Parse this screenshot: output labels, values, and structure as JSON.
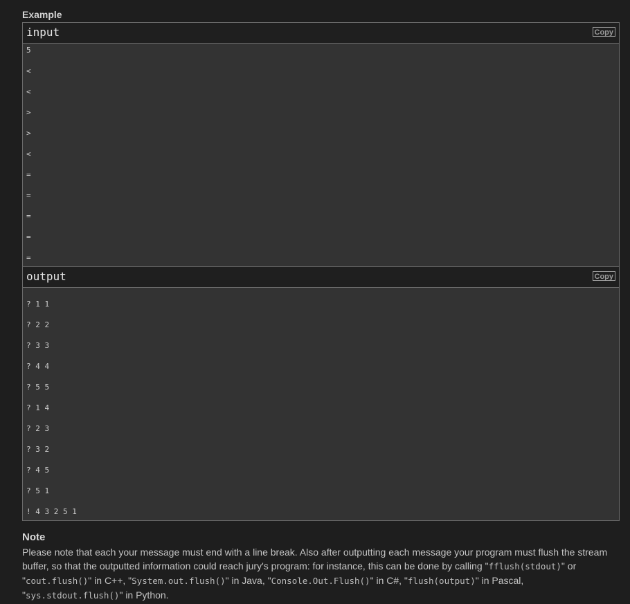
{
  "example": {
    "title": "Example"
  },
  "input": {
    "title": "input",
    "copy_label": "Copy",
    "lines": [
      "5",
      "<",
      "<",
      ">",
      ">",
      "<",
      "=",
      "=",
      "=",
      "=",
      "="
    ]
  },
  "output": {
    "title": "output",
    "copy_label": "Copy",
    "lines": [
      "? 1 1",
      "? 2 2",
      "? 3 3",
      "? 4 4",
      "? 5 5",
      "? 1 4",
      "? 2 3",
      "? 3 2",
      "? 4 5",
      "? 5 1",
      "! 4 3 2 5 1"
    ]
  },
  "note": {
    "title": "Note",
    "segments": [
      {
        "t": "text",
        "v": "Please note that each your message must end with a line break. Also after outputting each message your program must flush the stream buffer, so that the outputted information could reach jury's program: for instance, this can be done by calling \""
      },
      {
        "t": "code",
        "v": "fflush(stdout)"
      },
      {
        "t": "text",
        "v": "\" or \""
      },
      {
        "t": "code",
        "v": "cout.flush()"
      },
      {
        "t": "text",
        "v": "\" in C++, \""
      },
      {
        "t": "code",
        "v": "System.out.flush()"
      },
      {
        "t": "text",
        "v": "\" in Java, \""
      },
      {
        "t": "code",
        "v": "Console.Out.Flush()"
      },
      {
        "t": "text",
        "v": "\" in C#, \""
      },
      {
        "t": "code",
        "v": "flush(output)"
      },
      {
        "t": "text",
        "v": "\" in Pascal, \""
      },
      {
        "t": "code",
        "v": "sys.stdout.flush()"
      },
      {
        "t": "text",
        "v": "\" in Python."
      }
    ]
  }
}
